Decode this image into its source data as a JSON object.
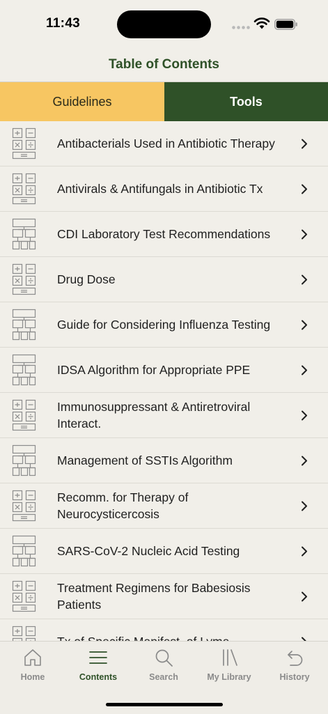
{
  "status": {
    "time": "11:43"
  },
  "header": {
    "title": "Table of Contents"
  },
  "tabs": [
    {
      "label": "Guidelines",
      "selected": false
    },
    {
      "label": "Tools",
      "selected": true
    }
  ],
  "items": [
    {
      "label": "Antibacterials Used in Antibiotic Therapy",
      "icon": "calculator-icon"
    },
    {
      "label": "Antivirals & Antifungals in Antibiotic Tx",
      "icon": "calculator-icon"
    },
    {
      "label": "CDI Laboratory Test Recommendations",
      "icon": "flowchart-icon"
    },
    {
      "label": "Drug Dose",
      "icon": "calculator-icon"
    },
    {
      "label": "Guide for Considering Influenza Testing",
      "icon": "flowchart-icon"
    },
    {
      "label": "IDSA Algorithm for Appropriate PPE",
      "icon": "flowchart-icon"
    },
    {
      "label": "Immunosuppressant & Antiretroviral Interact.",
      "icon": "calculator-icon"
    },
    {
      "label": "Management of SSTIs Algorithm",
      "icon": "flowchart-icon"
    },
    {
      "label": "Recomm. for Therapy of Neurocysticercosis",
      "icon": "calculator-icon"
    },
    {
      "label": "SARS-CoV-2 Nucleic Acid Testing",
      "icon": "flowchart-icon"
    },
    {
      "label": "Treatment Regimens for Babesiosis Patients",
      "icon": "calculator-icon"
    },
    {
      "label": "Tx of Specific Manifest. of Lyme",
      "icon": "calculator-icon"
    }
  ],
  "tabbar": [
    {
      "label": "Home",
      "icon": "home-icon",
      "active": false
    },
    {
      "label": "Contents",
      "icon": "menu-icon",
      "active": true
    },
    {
      "label": "Search",
      "icon": "search-icon",
      "active": false
    },
    {
      "label": "My Library",
      "icon": "library-icon",
      "active": false
    },
    {
      "label": "History",
      "icon": "history-icon",
      "active": false
    }
  ],
  "colors": {
    "brand_green": "#2f5128",
    "accent_yellow": "#f7c662",
    "background": "#f1efe9",
    "inactive_gray": "#8a8a8a"
  }
}
